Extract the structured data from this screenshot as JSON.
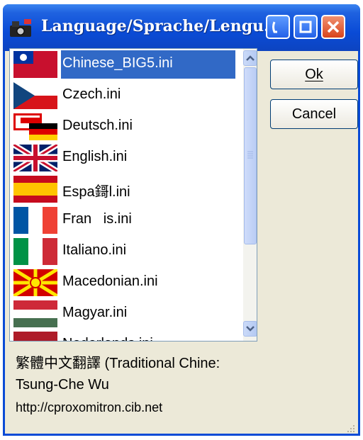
{
  "window": {
    "title": "Language/Sprache/Lengu...",
    "colors": {
      "titlebar": "#0a4bd6",
      "selection": "#3169c6",
      "face": "#ece9d8"
    }
  },
  "titlebar_buttons": {
    "minimize": "minimize-icon",
    "maximize": "maximize-icon",
    "close": "close-icon"
  },
  "languages": [
    {
      "label": "Chinese_BIG5.ini",
      "flag": "taiwan-flag-icon",
      "selected": true
    },
    {
      "label": "Czech.ini",
      "flag": "czech-flag-icon"
    },
    {
      "label": "Deutsch.ini",
      "flag": "germany-flag-icon"
    },
    {
      "label": "English.ini",
      "flag": "uk-flag-icon"
    },
    {
      "label": "Espa鎶l.ini",
      "flag": "spain-flag-icon"
    },
    {
      "label": "Fran   is.ini",
      "flag": "france-flag-icon"
    },
    {
      "label": "Italiano.ini",
      "flag": "italy-flag-icon"
    },
    {
      "label": "Macedonian.ini",
      "flag": "macedonia-flag-icon"
    },
    {
      "label": "Magyar.ini",
      "flag": "hungary-flag-icon"
    },
    {
      "label": "Nederlands.ini",
      "flag": "netherlands-flag-icon"
    }
  ],
  "buttons": {
    "ok": "Ok",
    "cancel": "Cancel"
  },
  "info": {
    "line1": "繁體中文翻譯 (Traditional Chine:",
    "line2": "Tsung-Che Wu",
    "line3": "http://cproxomitron.cib.net"
  }
}
